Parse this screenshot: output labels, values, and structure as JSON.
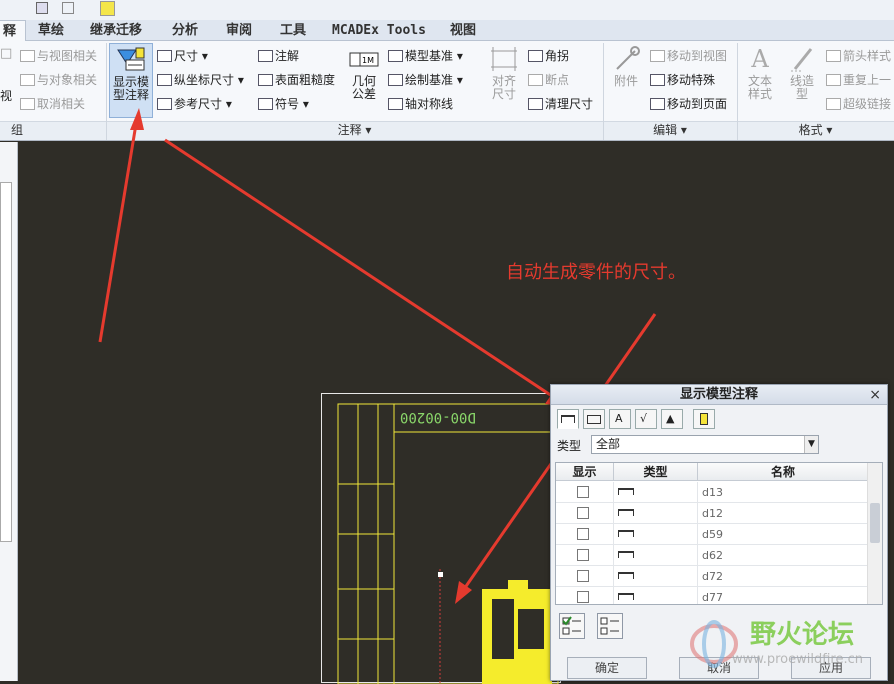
{
  "tabs": [
    {
      "label": "释",
      "active": true
    },
    {
      "label": "草绘"
    },
    {
      "label": "继承迁移"
    },
    {
      "label": "分析"
    },
    {
      "label": "审阅"
    },
    {
      "label": "工具"
    },
    {
      "label": "MCADEx Tools"
    },
    {
      "label": "视图"
    }
  ],
  "ribbon": {
    "group_left": {
      "label": "组",
      "items": [
        "与视图相关",
        "与对象相关",
        "取消相关"
      ],
      "cut_label": "视"
    },
    "show_model_annotations": "显示模型注释",
    "annotation_group": {
      "label": "注释 ▾",
      "col1": [
        "尺寸 ▾",
        "纵坐标尺寸 ▾",
        "参考尺寸 ▾"
      ],
      "col2": [
        "注解",
        "表面粗糙度",
        "符号 ▾"
      ],
      "geometric_tolerance": "几何公差",
      "col3": [
        "模型基准 ▾",
        "绘制基准 ▾",
        "轴对称线"
      ],
      "align_dims": "对齐尺寸",
      "col4": [
        "角拐",
        "断点",
        "清理尺寸"
      ]
    },
    "edit_group": {
      "label": "编辑 ▾",
      "attach": "附件",
      "items": [
        "移动到视图",
        "移动特殊",
        "移动到页面"
      ]
    },
    "format_group": {
      "label": "格式 ▾",
      "text_style": "文本样式",
      "line_style": "线造型",
      "items": [
        "箭头样式",
        "重复上一",
        "超级链接"
      ]
    }
  },
  "canvas": {
    "annotation_text": "自动生成零件的尺寸。",
    "drawing_number": "D00-00200"
  },
  "dialog": {
    "title": "显示模型注释",
    "close": "×",
    "type_label": "类型",
    "type_value": "全部",
    "columns": [
      "显示",
      "类型",
      "名称"
    ],
    "rows": [
      {
        "name": "d13"
      },
      {
        "name": "d12"
      },
      {
        "name": "d59"
      },
      {
        "name": "d62"
      },
      {
        "name": "d72"
      },
      {
        "name": "d77"
      }
    ],
    "ok": "确定",
    "cancel": "取消",
    "apply": "应用"
  },
  "watermark": {
    "title": "野火论坛",
    "url": "www.proewildfire.cn"
  }
}
